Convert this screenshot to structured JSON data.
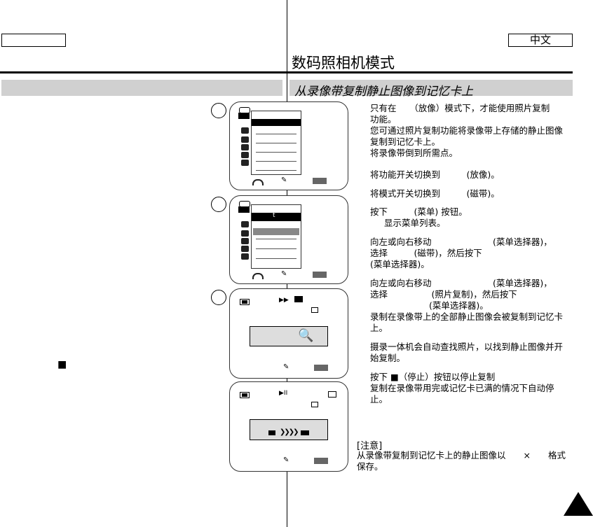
{
  "header": {
    "language_label": "中文",
    "page_title": "数码照相机模式",
    "section_title": "从录像带复制静止图像到记忆卡上"
  },
  "left": {
    "stop_symbol": "■"
  },
  "screens": {
    "menu_cursor": "t",
    "play_symbol": "▶▶",
    "pause_symbol": "▶II",
    "copy_arrows": "❯❯❯❯"
  },
  "instructions": [
    "只有在　　（放像）模式下，才能使用照片复制",
    "功能。",
    "您可通过照片复制功能将录像带上存储的静止图像",
    "复制到记忆卡上。",
    "将录像带倒到所需点。",
    "将功能开关切换到　　　(放像)。",
    "将模式开关切换到　　　(磁带)。",
    "按下　　　(菜单) 按钮。",
    "显示菜单列表。",
    "向左或向右移动　　　　　　　(菜单选择器)，",
    "选择　　　(磁带)，然后按下",
    "(菜单选择器)。",
    "向左或向右移动　　　　　　　(菜单选择器)，",
    "选择　　　　　(照片复制)，然后按下",
    "(菜单选择器)。",
    "录制在录像带上的全部静止图像会被复制到记忆卡",
    "上。",
    "摄录一体机会自动查找照片，以找到静止图像并开",
    "始复制。",
    "按下 ■（停止）按钮以停止复制",
    "复制在录像带用完或记忆卡已满的情况下自动停",
    "止。"
  ],
  "note": {
    "heading": "[注意]",
    "line1": "从录像带复制到记忆卡上的静止图像以　　×　　格式",
    "line2": "保存。"
  }
}
